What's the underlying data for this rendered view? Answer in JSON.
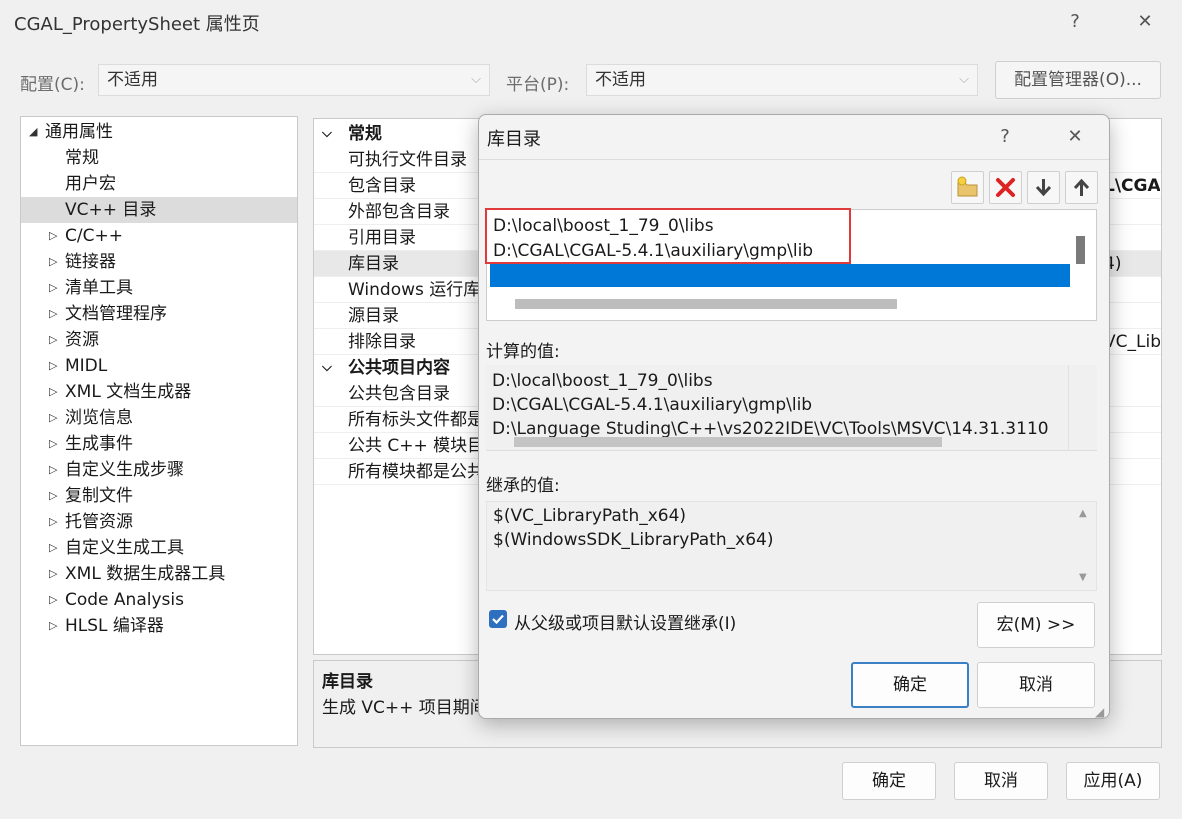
{
  "window": {
    "title": "CGAL_PropertySheet 属性页",
    "help": "?",
    "close": "✕"
  },
  "toolbar": {
    "config_label": "配置(C):",
    "config_value": "不适用",
    "platform_label": "平台(P):",
    "platform_value": "不适用",
    "config_manager": "配置管理器(O)..."
  },
  "tree": {
    "root": "通用属性",
    "children": [
      "常规",
      "用户宏",
      "VC++ 目录"
    ],
    "items": [
      "C/C++",
      "链接器",
      "清单工具",
      "文档管理程序",
      "资源",
      "MIDL",
      "XML 文档生成器",
      "浏览信息",
      "生成事件",
      "自定义生成步骤",
      "复制文件",
      "托管资源",
      "自定义生成工具",
      "XML 数据生成器工具",
      "Code Analysis",
      "HLSL 编译器"
    ]
  },
  "props": {
    "group1": "常规",
    "group1_items": [
      "可执行文件目录",
      "包含目录",
      "外部包含目录",
      "引用目录",
      "库目录",
      "Windows 运行库",
      "源目录",
      "排除目录"
    ],
    "group2": "公共项目内容",
    "group2_items": [
      "公共包含目录",
      "所有标头文件都是",
      "公共 C++ 模块目",
      "所有模块都是公共"
    ],
    "right_peek": [
      "L\\CGA",
      "4)",
      "VC_Lib"
    ]
  },
  "desc": {
    "title": "库目录",
    "text": "生成 VC++ 项目期间"
  },
  "bottom": {
    "ok": "确定",
    "cancel": "取消",
    "apply": "应用(A)"
  },
  "dialog": {
    "title": "库目录",
    "help": "?",
    "close": "✕",
    "entries": [
      "D:\\local\\boost_1_79_0\\libs",
      "D:\\CGAL\\CGAL-5.4.1\\auxiliary\\gmp\\lib"
    ],
    "computed_label": "计算的值:",
    "computed": [
      "D:\\local\\boost_1_79_0\\libs",
      "D:\\CGAL\\CGAL-5.4.1\\auxiliary\\gmp\\lib",
      "D:\\Language Studing\\C++\\vs2022IDE\\VC\\Tools\\MSVC\\14.31.3110"
    ],
    "inherited_label": "继承的值:",
    "inherited": [
      "$(VC_LibraryPath_x64)",
      "$(WindowsSDK_LibraryPath_x64)"
    ],
    "inherit_checkbox": "从父级或项目默认设置继承(I)",
    "macro": "宏(M) >>",
    "ok": "确定",
    "cancel": "取消"
  },
  "colors": {
    "selection": "#0078d7",
    "highlight_box": "#e03a3a",
    "checkbox": "#2f6fbf"
  }
}
